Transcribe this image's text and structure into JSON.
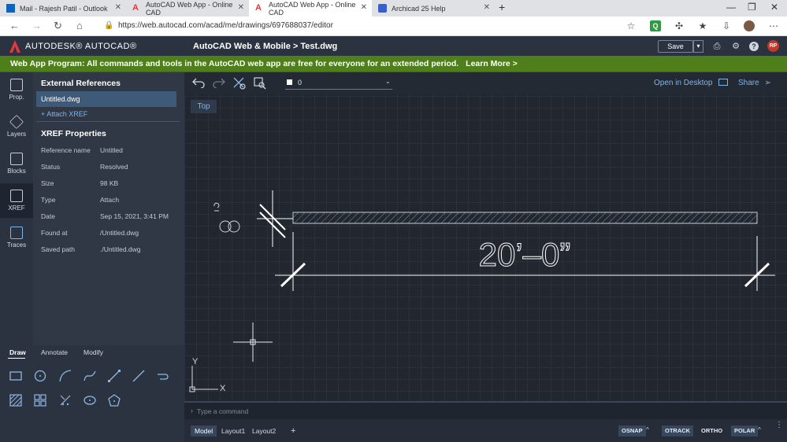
{
  "browser": {
    "tabs": [
      {
        "title": "Mail - Rajesh Patil - Outlook",
        "active": false
      },
      {
        "title": "AutoCAD Web App - Online CAD",
        "active": false
      },
      {
        "title": "AutoCAD Web App - Online CAD",
        "active": true
      },
      {
        "title": "Archicad 25 Help",
        "active": false
      }
    ],
    "url": "https://web.autocad.com/acad/me/drawings/697688037/editor"
  },
  "app": {
    "brand": "AUTODESK® AUTOCAD®",
    "title": "AutoCAD Web & Mobile  >  Test.dwg",
    "save_label": "Save",
    "avatar_initials": "RP",
    "brand_color": "#e03a3e"
  },
  "banner": {
    "text": "Web App Program: All commands and tools in the AutoCAD web app are free for everyone for an extended period.",
    "link": "Learn More >",
    "color": "#4e7f1a"
  },
  "rail": [
    {
      "label": "Prop.",
      "icon": "properties-icon"
    },
    {
      "label": "Layers",
      "icon": "layers-icon"
    },
    {
      "label": "Blocks",
      "icon": "blocks-icon"
    },
    {
      "label": "XREF",
      "icon": "xref-icon"
    },
    {
      "label": "Traces",
      "icon": "traces-icon"
    }
  ],
  "panel": {
    "title": "External References",
    "file": "Untitled.dwg",
    "attach_label": "Attach XREF",
    "props_title": "XREF Properties",
    "props": [
      {
        "key": "Reference name",
        "value": "Untitled"
      },
      {
        "key": "Status",
        "value": "Resolved"
      },
      {
        "key": "Size",
        "value": "98 KB"
      },
      {
        "key": "Type",
        "value": "Attach"
      },
      {
        "key": "Date",
        "value": "Sep 15, 2021, 3:41 PM"
      },
      {
        "key": "Found at",
        "value": "/Untitled.dwg"
      },
      {
        "key": "Saved path",
        "value": "./Untitled.dwg"
      }
    ]
  },
  "draw": {
    "tabs": [
      "Draw",
      "Annotate",
      "Modify"
    ],
    "tools_row1": [
      "rectangle-icon",
      "circle-icon",
      "arc-icon",
      "spline-icon",
      "line-arrow-icon",
      "line-icon",
      "polyline-icon"
    ],
    "tools_row2": [
      "hatch-icon",
      "array-icon",
      "trim-icon",
      "ellipse-icon",
      "polygon-icon"
    ]
  },
  "canvas": {
    "layer": "0",
    "open_desktop": "Open in Desktop",
    "share": "Share",
    "view": "Top",
    "dimension_text": "20’–0”",
    "ucs_x": "X",
    "ucs_y": "Y"
  },
  "command": {
    "placeholder": "Type a command"
  },
  "status": {
    "layouts": [
      "Model",
      "Layout1",
      "Layout2"
    ],
    "add": "+",
    "toggles": [
      {
        "label": "OSNAP",
        "on": true
      },
      {
        "label": "OTRACK",
        "on": true
      },
      {
        "label": "ORTHO",
        "on": false
      },
      {
        "label": "POLAR",
        "on": true
      }
    ]
  }
}
